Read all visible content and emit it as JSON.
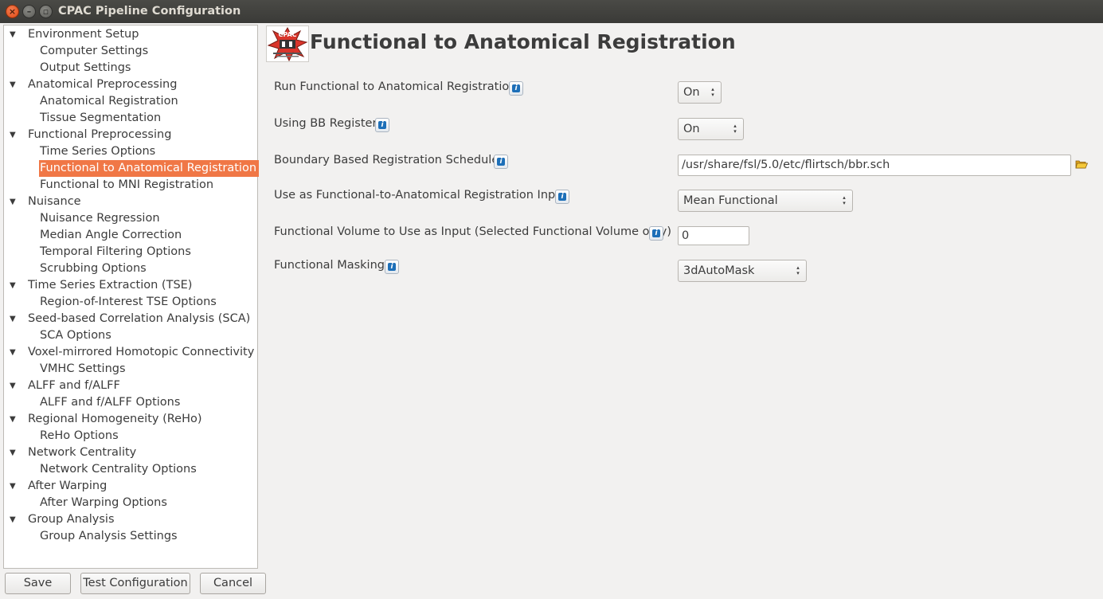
{
  "window": {
    "title": "CPAC Pipeline Configuration",
    "close_glyph": "×",
    "minimize_glyph": "–",
    "maximize_glyph": "▫"
  },
  "sidebar": {
    "items": [
      {
        "label": "Environment Setup",
        "type": "category"
      },
      {
        "label": "Computer Settings",
        "type": "child"
      },
      {
        "label": "Output Settings",
        "type": "child"
      },
      {
        "label": "Anatomical Preprocessing",
        "type": "category"
      },
      {
        "label": "Anatomical Registration",
        "type": "child"
      },
      {
        "label": "Tissue Segmentation",
        "type": "child"
      },
      {
        "label": "Functional Preprocessing",
        "type": "category"
      },
      {
        "label": "Time Series Options",
        "type": "child"
      },
      {
        "label": "Functional to Anatomical Registration",
        "type": "child",
        "selected": true
      },
      {
        "label": "Functional to MNI Registration",
        "type": "child"
      },
      {
        "label": "Nuisance",
        "type": "category"
      },
      {
        "label": "Nuisance Regression",
        "type": "child"
      },
      {
        "label": "Median Angle Correction",
        "type": "child"
      },
      {
        "label": "Temporal Filtering Options",
        "type": "child"
      },
      {
        "label": "Scrubbing Options",
        "type": "child"
      },
      {
        "label": "Time Series Extraction (TSE)",
        "type": "category"
      },
      {
        "label": "Region-of-Interest TSE Options",
        "type": "child"
      },
      {
        "label": "Seed-based Correlation Analysis (SCA)",
        "type": "category"
      },
      {
        "label": "SCA Options",
        "type": "child"
      },
      {
        "label": "Voxel-mirrored Homotopic Connectivity",
        "type": "category"
      },
      {
        "label": "VMHC Settings",
        "type": "child"
      },
      {
        "label": "ALFF and f/ALFF",
        "type": "category"
      },
      {
        "label": "ALFF and f/ALFF Options",
        "type": "child"
      },
      {
        "label": "Regional Homogeneity (ReHo)",
        "type": "category"
      },
      {
        "label": "ReHo Options",
        "type": "child"
      },
      {
        "label": "Network Centrality",
        "type": "category"
      },
      {
        "label": "Network Centrality Options",
        "type": "child"
      },
      {
        "label": "After Warping",
        "type": "category"
      },
      {
        "label": "After Warping Options",
        "type": "child"
      },
      {
        "label": "Group Analysis",
        "type": "category"
      },
      {
        "label": "Group Analysis Settings",
        "type": "child"
      }
    ],
    "expand_glyph": "▼"
  },
  "buttons": {
    "save": "Save",
    "test": "Test Configuration",
    "cancel": "Cancel"
  },
  "main": {
    "title": "Functional to Anatomical Registration",
    "logo_text": "CPAC",
    "help_glyph": "i",
    "fields": [
      {
        "label": "Run Functional to Anatomical Registration",
        "value": "On"
      },
      {
        "label": "Using BB Register",
        "value": "On"
      },
      {
        "label": "Boundary Based Registration Scheduler",
        "value": "/usr/share/fsl/5.0/etc/flirtsch/bbr.sch"
      },
      {
        "label": "Use as Functional-to-Anatomical Registration Input",
        "value": "Mean Functional"
      },
      {
        "label": "Functional Volume to Use as Input (Selected Functional Volume only)",
        "value": "0"
      },
      {
        "label": "Functional Masking",
        "value": "3dAutoMask"
      }
    ]
  },
  "colors": {
    "selection": "#f07746",
    "titlebar": "#3c3b37",
    "help_icon": "#1d6fb8"
  },
  "icons": [
    "close-icon",
    "minimize-icon",
    "maximize-icon",
    "expand-arrow-icon",
    "help-icon",
    "folder-open-icon",
    "cpac-logo"
  ]
}
